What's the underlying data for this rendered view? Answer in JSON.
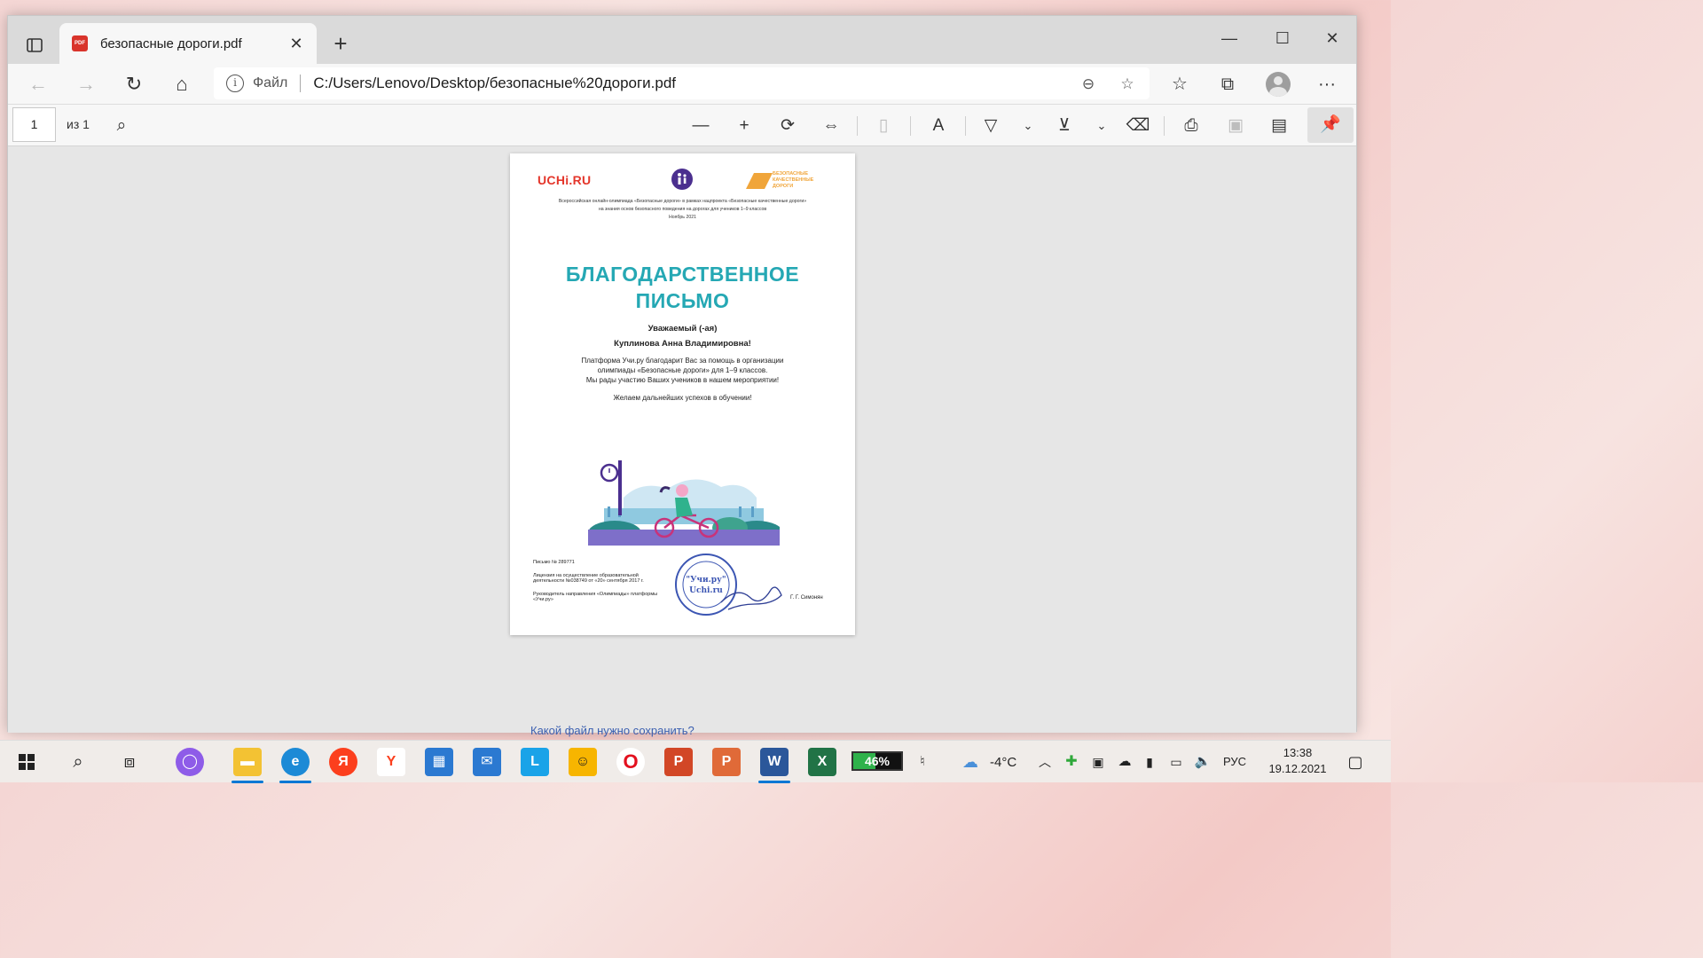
{
  "browser": {
    "tab_title": "безопасные дороги.pdf",
    "tab_icon_text": "PDF",
    "address_scheme": "Файл",
    "address_url": "C:/Users/Lenovo/Desktop/безопасные%20дороги.pdf"
  },
  "pdf_toolbar": {
    "page_current": "1",
    "page_of": "из 1"
  },
  "document": {
    "logo_left": "UCHi.RU",
    "logo_right_line1": "БЕЗОПАСНЫЕ",
    "logo_right_line2": "КАЧЕСТВЕННЫЕ ДОРОГИ",
    "header_line1": "Всероссийская онлайн-олимпиада «Безопасные дороги» в рамках нацпроекта «Безопасные качественные дороги»",
    "header_line2": "на знания основ безопасного поведения на дорогах для учеников 1–9 классов",
    "header_line3": "Ноябрь 2021",
    "title_line1": "БЛАГОДАРСТВЕННОЕ",
    "title_line2": "ПИСЬМО",
    "salutation": "Уважаемый (-ая)",
    "recipient": "Куплинова Анна Владимировна!",
    "body_line1": "Платформа Учи.ру благодарит Вас за помощь в организации",
    "body_line2": "олимпиады «Безопасные дороги» для 1–9 классов.",
    "body_line3": "Мы рады участию Ваших учеников в нашем мероприятии!",
    "wish": "Желаем дальнейших успехов в обучении!",
    "letter_number": "Письмо № 289771",
    "license": "Лицензия на осуществление образовательной деятельности №038749 от «20» сентября 2017 г.",
    "position": "Руководитель направления «Олимпиады» платформы «Учи.ру»",
    "stamp_line1": "\"Учи.ру\"",
    "stamp_line2": "Uchi.ru",
    "signer": "Г. Г. Симонян"
  },
  "background_snippet": "Какой файл нужно сохранить?",
  "taskbar": {
    "battery_pct": "46%",
    "battery_level": 0.46,
    "weather": "-4°C",
    "language": "РУС",
    "time": "13:38",
    "date": "19.12.2021"
  },
  "colors": {
    "title_teal": "#25a8b4",
    "uchi_red": "#e4362b",
    "road_orange": "#f0a53a",
    "accent_blue": "#0078d4"
  }
}
